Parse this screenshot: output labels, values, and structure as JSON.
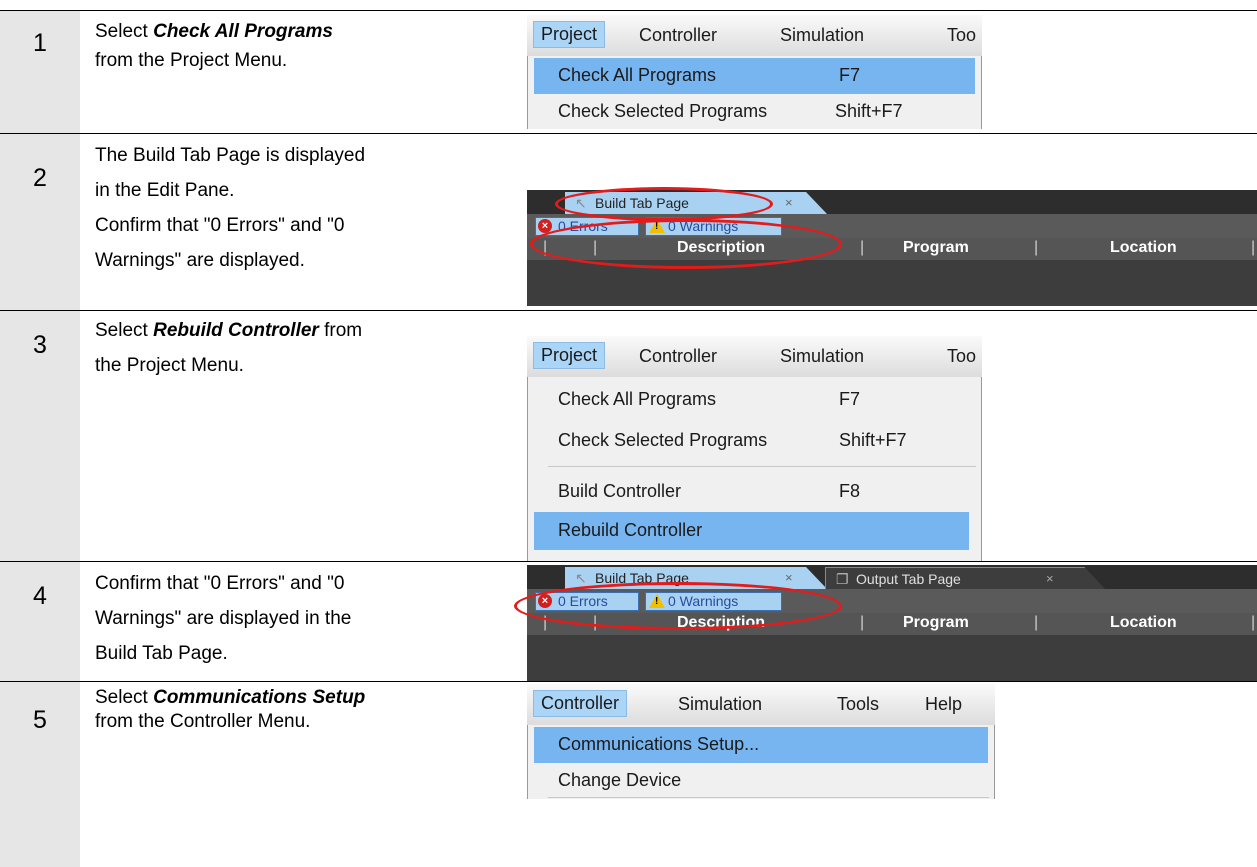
{
  "steps": [
    {
      "num": "1",
      "pre": "Select ",
      "bold": "Check All Programs",
      "post": "from the Project Menu."
    },
    {
      "num": "2",
      "lines": [
        "The Build Tab Page is displayed",
        "in the Edit Pane.",
        "Confirm that \"0 Errors\" and \"0",
        "Warnings\" are displayed."
      ]
    },
    {
      "num": "3",
      "pre": "Select ",
      "bold": "Rebuild Controller",
      "post": " from",
      "line2": "the Project Menu."
    },
    {
      "num": "4",
      "lines": [
        "Confirm that \"0 Errors\" and \"0",
        "Warnings\" are displayed in the",
        "Build Tab Page."
      ]
    },
    {
      "num": "5",
      "pre": "Select ",
      "bold": "Communications Setup",
      "post": "from the Controller Menu."
    }
  ],
  "menus": {
    "bar1": [
      "Project",
      "Controller",
      "Simulation",
      "Too"
    ],
    "bar5": [
      "Controller",
      "Simulation",
      "Tools",
      "Help"
    ],
    "check_all": "Check All Programs",
    "check_all_key": "F7",
    "check_sel": "Check Selected Programs",
    "check_sel_key": "Shift+F7",
    "build": "Build Controller",
    "build_key": "F8",
    "rebuild": "Rebuild Controller",
    "comm": "Communications Setup...",
    "change": "Change Device"
  },
  "build_tab": {
    "tab": "Build Tab Page",
    "tab_close": "×",
    "output_tab": "Output Tab Page",
    "errors": "0  Errors",
    "warnings": "0  Warnings",
    "col_desc": "Description",
    "col_prog": "Program",
    "col_loc": "Location",
    "sep": "|"
  },
  "colors": {
    "highlight": "#77b5f1",
    "annotation": "#e41b1b",
    "left_cell": "#e6e6e6"
  }
}
